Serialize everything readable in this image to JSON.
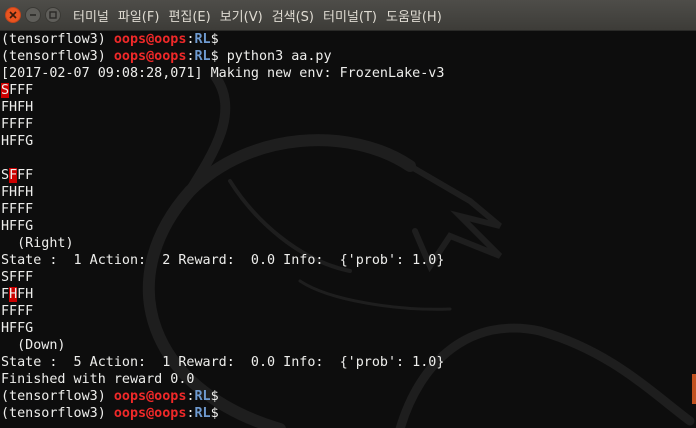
{
  "window": {
    "menu": [
      "터미널",
      "파일(F)",
      "편집(E)",
      "보기(V)",
      "검색(S)",
      "터미널(T)",
      "도움말(H)"
    ]
  },
  "terminal": {
    "colors": {
      "user_host": "#ef2929",
      "path": "#6f9bd1",
      "text": "#eeeeec",
      "highlight": "#cc0000",
      "background": "#0d0d0d"
    },
    "prompt": {
      "env": "(tensorflow3) ",
      "user_host": "oops@oops",
      "sep": ":",
      "path": "RL",
      "symbol": "$ "
    },
    "command": "python3 aa.py",
    "log_line": "[2017-02-07 09:08:28,071] Making new env: FrozenLake-v3",
    "grid1": {
      "r1_hl": "S",
      "r1_rest": "FFF",
      "r2": "FHFH",
      "r3": "FFFF",
      "r4": "HFFG"
    },
    "grid2": {
      "r1_pre": "S",
      "r1_hl": "F",
      "r1_rest": "FF",
      "r2": "FHFH",
      "r3": "FFFF",
      "r4": "HFFG"
    },
    "action1": "  (Right)",
    "state1": "State :  1 Action:  2 Reward:  0.0 Info:  {'prob': 1.0}",
    "grid3": {
      "r1": "SFFF",
      "r2_pre": "F",
      "r2_hl": "H",
      "r2_rest": "FH",
      "r3": "FFFF",
      "r4": "HFFG"
    },
    "action2": "  (Down)",
    "state2": "State :  5 Action:  1 Reward:  0.0 Info:  {'prob': 1.0}",
    "finish": "Finished with reward 0.0"
  }
}
